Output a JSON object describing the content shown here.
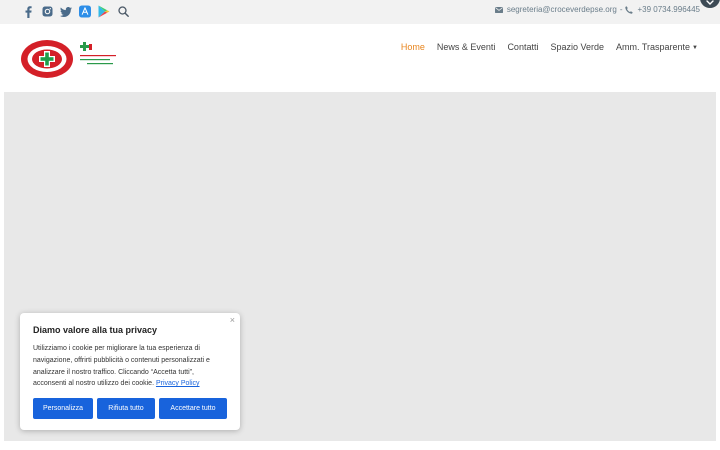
{
  "topbar": {
    "social_icons": [
      "facebook-icon",
      "instagram-icon",
      "twitter-icon",
      "app-store-icon",
      "google-play-icon",
      "search-icon"
    ],
    "email": "segreteria@croceverdepse.org",
    "separator": "-",
    "phone": "+39 0734.996445"
  },
  "header": {
    "nav": [
      {
        "label": "Home",
        "active": true
      },
      {
        "label": "News & Eventi"
      },
      {
        "label": "Contatti"
      },
      {
        "label": "Spazio Verde"
      },
      {
        "label": "Amm. Trasparente",
        "dropdown": true
      }
    ],
    "accent": "#e8851e"
  },
  "cookie": {
    "title": "Diamo valore alla tua privacy",
    "close": "×",
    "lines": [
      "Utilizziamo i cookie per migliorare la tua esperienza di",
      "navigazione, offrirti pubblicità o contenuti personalizzati e",
      "analizzare il nostro traffico. Cliccando “Accetta tutti”,",
      "acconsenti al nostro utilizzo dei cookie."
    ],
    "policy_link": "Privacy Policy",
    "buttons": {
      "customize": "Personalizza",
      "reject": "Rifiuta tutto",
      "accept": "Accettare tutto"
    },
    "button_color": "#1863dc"
  }
}
